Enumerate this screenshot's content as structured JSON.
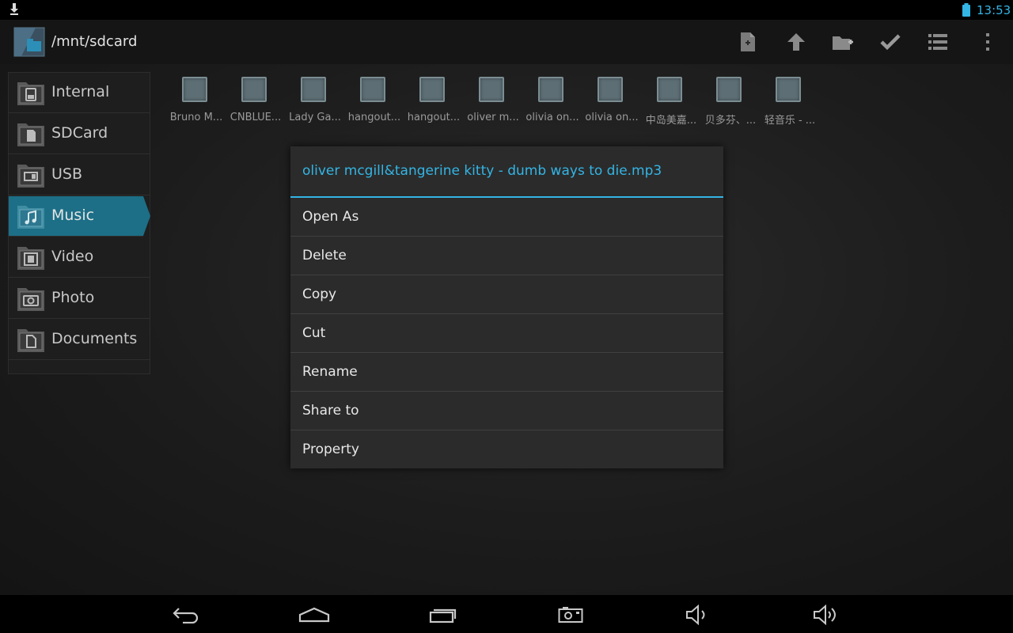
{
  "status_bar": {
    "time": "13:53",
    "icons": [
      "download-icon",
      "battery-icon"
    ],
    "accent_color": "#33b5e5"
  },
  "action_bar": {
    "path": "/mnt/sdcard",
    "actions": [
      "new-file-icon",
      "up-icon",
      "new-folder-icon",
      "select-icon",
      "list-view-icon",
      "overflow-menu-icon"
    ]
  },
  "sidebar": {
    "items": [
      {
        "label": "Internal",
        "icon": "phone-storage-icon",
        "active": false
      },
      {
        "label": "SDCard",
        "icon": "sdcard-icon",
        "active": false
      },
      {
        "label": "USB",
        "icon": "usb-icon",
        "active": false
      },
      {
        "label": "Music",
        "icon": "music-note-icon",
        "active": true
      },
      {
        "label": "Video",
        "icon": "film-icon",
        "active": false
      },
      {
        "label": "Photo",
        "icon": "camera-icon",
        "active": false
      },
      {
        "label": "Documents",
        "icon": "document-icon",
        "active": false
      }
    ],
    "active_color": "#1c6f86"
  },
  "files": [
    {
      "name": "Bruno M..."
    },
    {
      "name": "CNBLUE..."
    },
    {
      "name": "Lady Ga..."
    },
    {
      "name": "hangout..."
    },
    {
      "name": "hangout..."
    },
    {
      "name": "oliver m..."
    },
    {
      "name": "olivia on..."
    },
    {
      "name": "olivia on..."
    },
    {
      "name": "中岛美嘉..."
    },
    {
      "name": "贝多芬、..."
    },
    {
      "name": "轻音乐 - ..."
    }
  ],
  "dialog": {
    "title": "oliver mcgill&tangerine kitty - dumb ways to die.mp3",
    "items": [
      "Open As",
      "Delete",
      "Copy",
      "Cut",
      "Rename",
      "Share to",
      "Property"
    ]
  },
  "nav_bar": {
    "buttons": [
      "back-icon",
      "home-icon",
      "recent-apps-icon",
      "screenshot-icon",
      "volume-down-icon",
      "volume-up-icon"
    ]
  }
}
